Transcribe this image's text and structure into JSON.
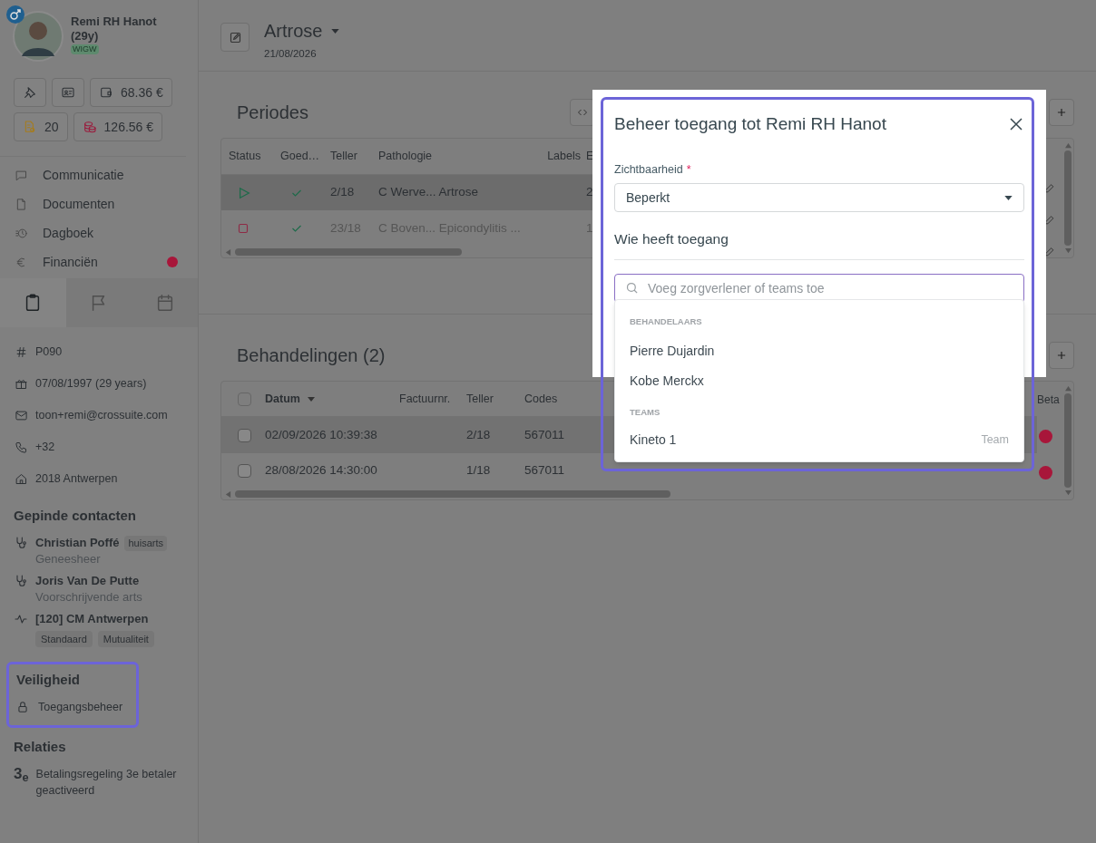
{
  "patient": {
    "name": "Remi RH Hanot (29y)",
    "badge": "WIGW"
  },
  "quick_buttons": [
    {
      "kind": "pin"
    },
    {
      "kind": "id"
    },
    {
      "kind": "wallet",
      "label": "68.36 €"
    },
    {
      "kind": "invoice",
      "label": "20"
    },
    {
      "kind": "coins",
      "label": "126.56 €"
    }
  ],
  "nav": [
    {
      "kind": "chat",
      "label": "Communicatie",
      "alert": false
    },
    {
      "kind": "file",
      "label": "Documenten",
      "alert": false
    },
    {
      "kind": "history",
      "label": "Dagboek",
      "alert": false
    },
    {
      "kind": "euro",
      "label": "Financiën",
      "alert": true
    }
  ],
  "side_tabs": [
    {
      "kind": "clipboard",
      "selected": true
    },
    {
      "kind": "flag",
      "selected": false
    },
    {
      "kind": "calendar",
      "selected": false
    }
  ],
  "info": [
    {
      "kind": "hash",
      "text": "P090"
    },
    {
      "kind": "gift",
      "text": "07/08/1997 (29 years)"
    },
    {
      "kind": "mail",
      "text": "toon+remi@crossuite.com"
    },
    {
      "kind": "phone",
      "text": "+32"
    },
    {
      "kind": "home",
      "text": "2018 Antwerpen"
    }
  ],
  "pinned_contacts": {
    "title": "Gepinde contacten",
    "items": [
      {
        "kind": "doctor",
        "name": "Christian Poffé",
        "tags": [
          "huisarts"
        ],
        "role": "Geneesheer"
      },
      {
        "kind": "doctor",
        "name": "Joris Van De Putte",
        "role": "Voorschrijvende arts"
      },
      {
        "kind": "insurer",
        "name": "[120] CM Antwerpen",
        "tags": [
          "Standaard",
          "Mutualiteit"
        ]
      }
    ]
  },
  "security": {
    "title": "Veiligheid",
    "highlighted": true,
    "items": [
      {
        "label": "Toegangsbeheer"
      }
    ]
  },
  "relations": {
    "title": "Relaties",
    "items": [
      {
        "icon_text": "3$_{e}$",
        "label": "Betalingsregeling 3e betaler geactiveerd"
      }
    ]
  },
  "header": {
    "title": "Artrose",
    "date": "21/08/2026"
  },
  "periodes": {
    "title": "Periodes",
    "columns": [
      "Status",
      "Goed…",
      "Teller",
      "Pathologie",
      "Labels",
      "E"
    ],
    "rows": [
      {
        "kind": "active",
        "approved": true,
        "teller": "2/18",
        "pathologie": "C Werve... Artrose",
        "column_6": "2",
        "selected": true
      },
      {
        "kind": "stopped",
        "approved": true,
        "teller": "23/18",
        "pathologie": "C Boven... Epicondylitis ...",
        "column_6": "1",
        "selected": false
      }
    ]
  },
  "behandelingen": {
    "title": "Behandelingen (2)",
    "all_checked": false,
    "columns": [
      "Datum",
      "Factuurnr.",
      "Teller",
      "Codes",
      "Beta"
    ],
    "rows": [
      {
        "checked": false,
        "datum": "02/09/2026 10:39:38",
        "teller": "2/18",
        "codes": "567011",
        "color": "#a8163a",
        "selected": true
      },
      {
        "checked": false,
        "datum": "28/08/2026 14:30:00",
        "teller": "1/18",
        "codes": "567011",
        "color": "#a8163a",
        "selected": false
      }
    ]
  },
  "modal": {
    "title": "Beheer toegang tot Remi RH Hanot",
    "highlighted": true,
    "field_label": "Zichtbaarheid",
    "required_mark": "*",
    "value": "Beperkt",
    "section": "Wie heeft toegang",
    "search_placeholder": "Voeg zorgverlener of teams toe",
    "dropdown": [
      {
        "group": "BEHANDELAARS",
        "options": [
          {
            "label": "Pierre Dujardin"
          },
          {
            "label": "Kobe Merckx"
          }
        ]
      },
      {
        "group": "TEAMS",
        "options": [
          {
            "label": "Kineto 1",
            "hint": "Team"
          }
        ]
      }
    ]
  }
}
